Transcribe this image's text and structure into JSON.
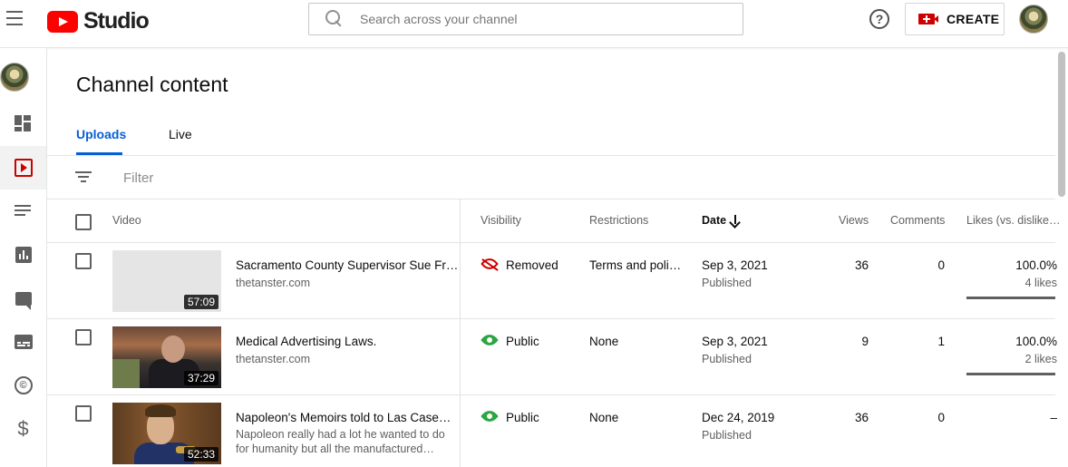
{
  "header": {
    "logo_text": "Studio",
    "search_placeholder": "Search across your channel",
    "help_label": "?",
    "create_label": "CREATE"
  },
  "page": {
    "title": "Channel content",
    "tabs": [
      {
        "label": "Uploads",
        "active": true
      },
      {
        "label": "Live",
        "active": false
      }
    ],
    "filter_placeholder": "Filter"
  },
  "sidebar": {
    "items": [
      {
        "icon": "dashboard-icon"
      },
      {
        "icon": "content-icon",
        "active": true
      },
      {
        "icon": "playlists-icon"
      },
      {
        "icon": "analytics-icon"
      },
      {
        "icon": "comments-icon"
      },
      {
        "icon": "subtitles-icon"
      },
      {
        "icon": "copyright-icon",
        "glyph": "©"
      },
      {
        "icon": "monetization-icon",
        "glyph": "$"
      }
    ]
  },
  "table": {
    "headers": {
      "video": "Video",
      "visibility": "Visibility",
      "restrictions": "Restrictions",
      "date": "Date",
      "views": "Views",
      "comments": "Comments",
      "likes": "Likes (vs. dislike…"
    },
    "rows": [
      {
        "title": "Sacramento County Supervisor Sue Fr…",
        "subtitle": "thetanster.com",
        "duration": "57:09",
        "visibility": "Removed",
        "restrictions": "Terms and poli…",
        "date": "Sep 3, 2021",
        "date_status": "Published",
        "views": "36",
        "comments": "0",
        "likes_pct": "100.0%",
        "likes_count": "4 likes"
      },
      {
        "title": "Medical Advertising Laws.",
        "subtitle": "thetanster.com",
        "duration": "37:29",
        "visibility": "Public",
        "restrictions": "None",
        "date": "Sep 3, 2021",
        "date_status": "Published",
        "views": "9",
        "comments": "1",
        "likes_pct": "100.0%",
        "likes_count": "2 likes"
      },
      {
        "title": "Napoleon's Memoirs told to Las Case…",
        "subtitle": "Napoleon really had a lot he wanted to do for humanity but all the manufactured…",
        "duration": "52:33",
        "visibility": "Public",
        "restrictions": "None",
        "date": "Dec 24, 2019",
        "date_status": "Published",
        "views": "36",
        "comments": "0",
        "likes_pct": "–"
      }
    ]
  },
  "colors": {
    "accent_blue": "#065fd4",
    "brand_red": "#ff0000",
    "public_green": "#2ba640",
    "removed_red": "#cc0000"
  }
}
